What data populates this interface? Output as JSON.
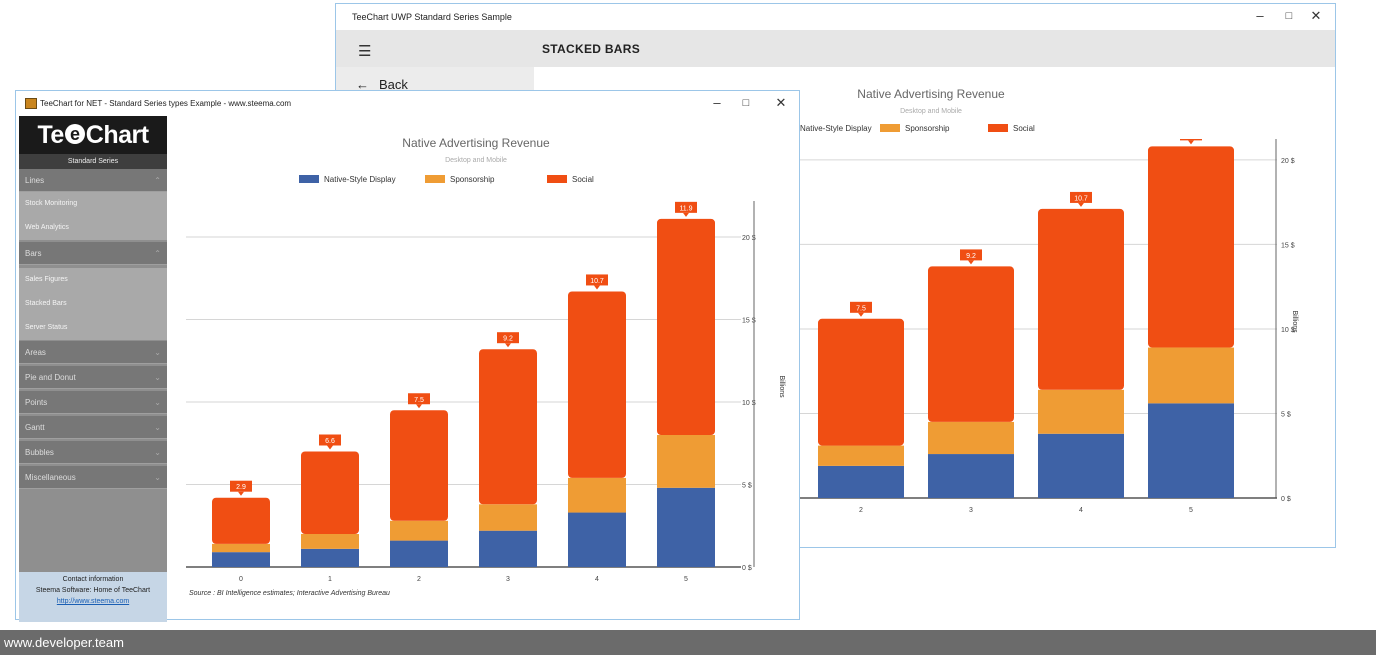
{
  "colors": {
    "native": "#3e62a6",
    "sponsorship": "#ef9c34",
    "social": "#f04e13",
    "label_bg": "#f04e13"
  },
  "uwp_window": {
    "title": "TeeChart UWP Standard Series Sample",
    "header_title": "STACKED BARS",
    "back_label": "Back",
    "chart": {
      "title": "Native Advertising Revenue",
      "subtitle": "Desktop and Mobile",
      "legend": [
        "Native-Style Display",
        "Sponsorship",
        "Social"
      ]
    }
  },
  "wf_window": {
    "title": "TeeChart for NET - Standard Series types Example - www.steema.com",
    "sidebar": {
      "logo_left": "Te",
      "logo_right": "Chart",
      "subtitle": "Standard Series",
      "groups": [
        {
          "label": "Lines",
          "items": [
            "Stock Monitoring",
            "Web Analytics"
          ]
        },
        {
          "label": "Bars",
          "items": [
            "Sales Figures",
            "Stacked Bars",
            "Server Status"
          ]
        },
        {
          "label": "Areas",
          "items": []
        },
        {
          "label": "Pie and Donut",
          "items": []
        },
        {
          "label": "Points",
          "items": []
        },
        {
          "label": "Gantt",
          "items": []
        },
        {
          "label": "Bubbles",
          "items": []
        },
        {
          "label": "Miscellaneous",
          "items": []
        }
      ],
      "contact": {
        "heading": "Contact information",
        "line": "Steema Software: Home of TeeChart",
        "link": "http://www.steema.com"
      }
    },
    "chart": {
      "title": "Native Advertising Revenue",
      "subtitle": "Desktop and Mobile",
      "legend": [
        "Native-Style Display",
        "Sponsorship",
        "Social"
      ],
      "ylabel": "Billions",
      "source": "Source : BI Intelligence estimates; Interactive Advertising Bureau"
    }
  },
  "chart_data": [
    {
      "type": "bar",
      "stacked": true,
      "title": "Native Advertising Revenue",
      "subtitle": "Desktop and Mobile",
      "categories": [
        "0",
        "1",
        "2",
        "3",
        "4",
        "5"
      ],
      "series": [
        {
          "name": "Native-Style Display",
          "values": [
            0.9,
            1.1,
            1.6,
            2.2,
            3.3,
            4.8
          ]
        },
        {
          "name": "Sponsorship",
          "values": [
            0.5,
            0.9,
            1.2,
            1.6,
            2.1,
            3.2
          ]
        },
        {
          "name": "Social",
          "values": [
            2.8,
            5.0,
            6.7,
            9.4,
            11.3,
            13.1
          ]
        }
      ],
      "data_labels": [
        "2.9",
        "6.6",
        "7.5",
        "9.2",
        "10.7",
        "11.9"
      ],
      "ylim": [
        0,
        22
      ],
      "yticks": [
        "0 $",
        "5 $",
        "10 $",
        "15 $",
        "20 $"
      ],
      "ylabel": "Billions",
      "legend_position": "top"
    },
    {
      "type": "bar",
      "stacked": true,
      "title": "Native Advertising Revenue",
      "subtitle": "Desktop and Mobile",
      "categories": [
        "2",
        "3",
        "4",
        "5"
      ],
      "series": [
        {
          "name": "Native-Style Display",
          "values": [
            1.9,
            2.6,
            3.8,
            5.6
          ]
        },
        {
          "name": "Sponsorship",
          "values": [
            1.2,
            1.9,
            2.6,
            3.3
          ]
        },
        {
          "name": "Social",
          "values": [
            7.5,
            9.2,
            10.7,
            11.9
          ]
        }
      ],
      "data_labels": [
        "7.5",
        "9.2",
        "10.7",
        "11.9"
      ],
      "ylim": [
        0,
        21
      ],
      "yticks": [
        "0 $",
        "5 $",
        "10 $",
        "15 $",
        "20 $"
      ],
      "ylabel": "Billions",
      "legend_position": "top"
    }
  ],
  "footer": {
    "text": "www.developer.team"
  }
}
